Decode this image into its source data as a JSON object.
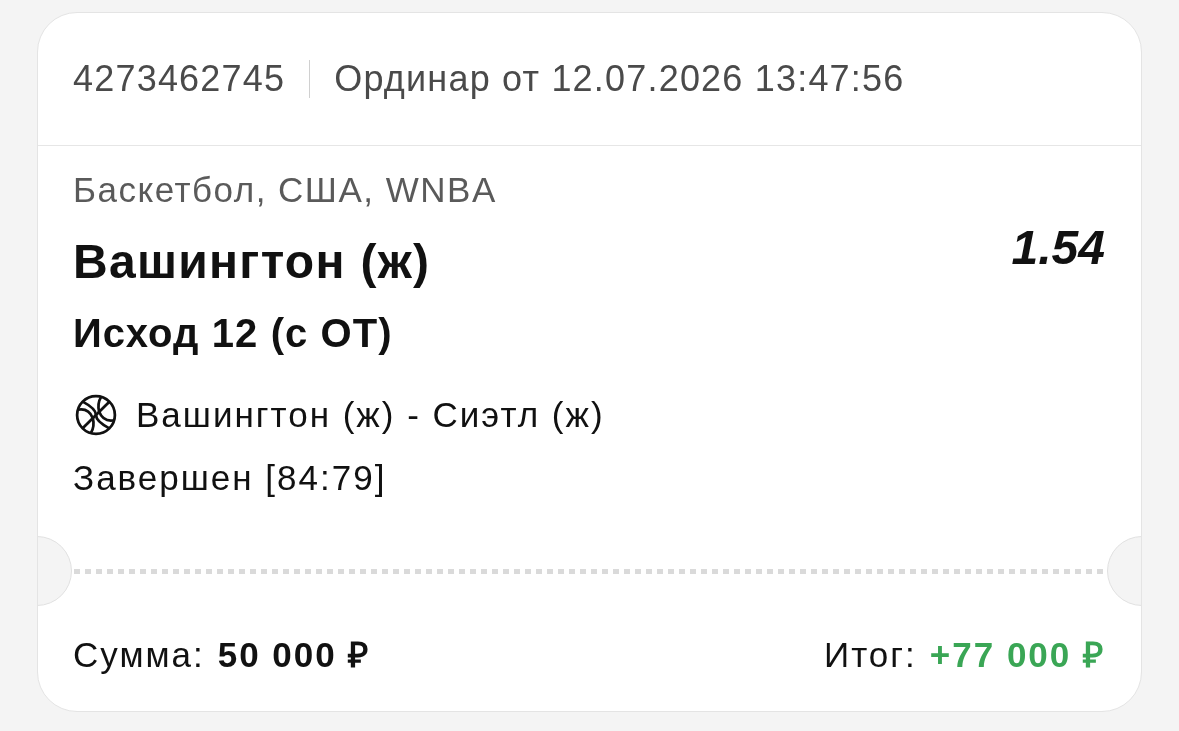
{
  "header": {
    "bet_number": "4273462745",
    "bet_title": "Ординар от 12.07.2026 13:47:56"
  },
  "selection": {
    "league": "Баскетбол, США, WNBA",
    "pick": "Вашингтон (ж)",
    "odds": "1.54",
    "market": "Исход 12 (с ОТ)",
    "event": "Вашингтон (ж) - Сиэтл (ж)",
    "status": "Завершен [84:79]"
  },
  "footer": {
    "stake_label": "Сумма:",
    "stake": "50 000 ₽",
    "result_label": "Итог:",
    "result": "+77 000 ₽",
    "won": true
  }
}
